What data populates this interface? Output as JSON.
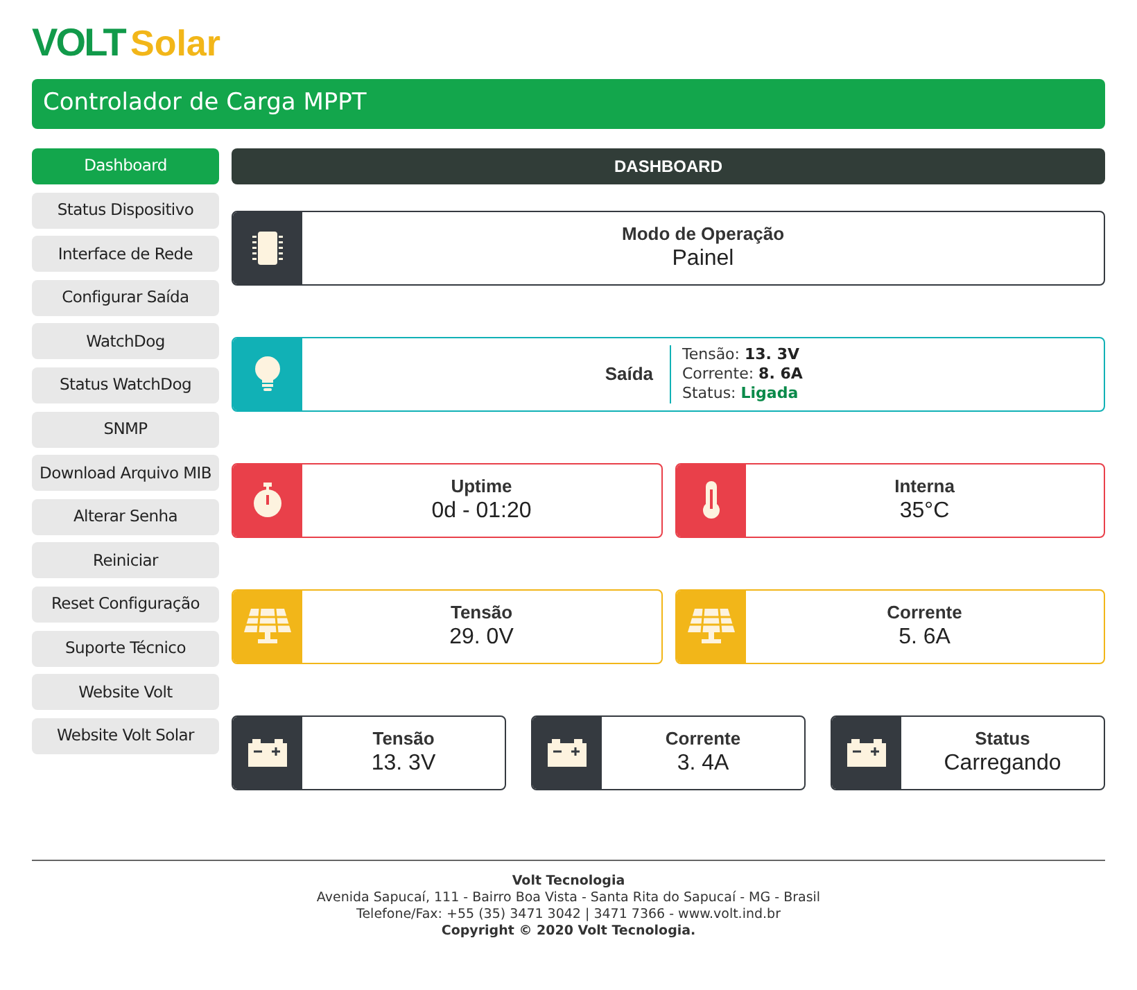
{
  "logo": {
    "primary": "VOLT",
    "secondary": "Solar"
  },
  "header": {
    "title": "Controlador de Carga MPPT"
  },
  "sidebar": {
    "items": [
      {
        "label": "Dashboard",
        "selected": true
      },
      {
        "label": "Status Dispositivo",
        "selected": false
      },
      {
        "label": "Interface de Rede",
        "selected": false
      },
      {
        "label": "Configurar Saída",
        "selected": false
      },
      {
        "label": "WatchDog",
        "selected": false
      },
      {
        "label": "Status WatchDog",
        "selected": false
      },
      {
        "label": "SNMP",
        "selected": false
      },
      {
        "label": "Download Arquivo MIB",
        "selected": false
      },
      {
        "label": "Alterar Senha",
        "selected": false
      },
      {
        "label": "Reiniciar",
        "selected": false
      },
      {
        "label": "Reset Configuração",
        "selected": false
      },
      {
        "label": "Suporte Técnico",
        "selected": false
      },
      {
        "label": "Website Volt",
        "selected": false
      },
      {
        "label": "Website Volt Solar",
        "selected": false
      }
    ]
  },
  "main": {
    "title": "DASHBOARD",
    "rows": [
      [
        {
          "kind": "single",
          "color": "#353a40",
          "label": "Modo de Operação",
          "value": "Painel"
        }
      ],
      [
        {
          "kind": "output",
          "color": "#11b1b6",
          "label": "Saída",
          "details": [
            {
              "kind": "reading",
              "label": "Tensão:",
              "value": "13. 3V"
            },
            {
              "kind": "reading",
              "label": "Corrente:",
              "value": "8. 6A"
            },
            {
              "kind": "status",
              "label": "Status:",
              "value": "Ligada"
            }
          ]
        }
      ],
      [
        {
          "kind": "single",
          "color": "#e9404a",
          "label": "Uptime",
          "value": "0d - 01:20"
        },
        {
          "kind": "single",
          "color": "#e9404a",
          "label": "Interna",
          "value": "35°C"
        }
      ],
      [
        {
          "kind": "single",
          "color": "#f2b619",
          "label": "Tensão",
          "value": "29. 0V"
        },
        {
          "kind": "single",
          "color": "#f2b619",
          "label": "Corrente",
          "value": "5. 6A"
        }
      ],
      [
        {
          "kind": "single",
          "color": "#353a40",
          "label": "Tensão",
          "value": "13. 3V"
        },
        {
          "kind": "single",
          "color": "#353a40",
          "label": "Corrente",
          "value": "3. 4A"
        },
        {
          "kind": "single",
          "color": "#353a40",
          "label": "Status",
          "value": "Carregando"
        }
      ]
    ]
  },
  "footer": {
    "lines": [
      {
        "kind": "title",
        "text": "Volt Tecnologia"
      },
      {
        "kind": "text",
        "text": "Avenida Sapucaí, 111 - Bairro Boa Vista - Santa Rita do Sapucaí - MG - Brasil"
      },
      {
        "kind": "text",
        "text": "Telefone/Fax: +55 (35) 3471 3042 | 3471 7366 - www.volt.ind.br"
      },
      {
        "kind": "title",
        "text": "Copyright © 2020 Volt Tecnologia."
      }
    ]
  }
}
